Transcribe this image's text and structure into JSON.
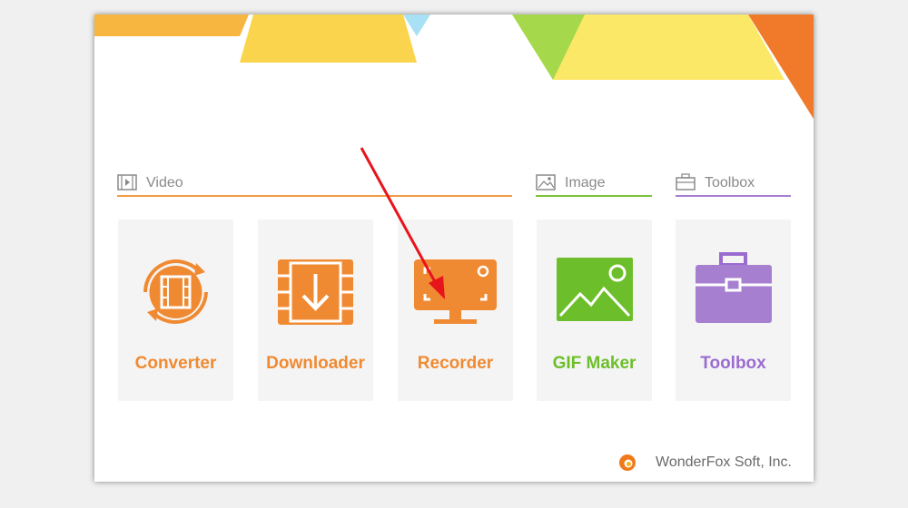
{
  "sections": {
    "video": {
      "label": "Video",
      "icon": "film-icon",
      "color": "#f39a45"
    },
    "image": {
      "label": "Image",
      "icon": "picture-icon",
      "color": "#7cc23a"
    },
    "toolbox": {
      "label": "Toolbox",
      "icon": "briefcase-icon",
      "color": "#a77fd0"
    }
  },
  "cards": [
    {
      "label": "Converter",
      "icon": "converter-film-icon",
      "color": "#f08a32"
    },
    {
      "label": "Downloader",
      "icon": "download-film-icon",
      "color": "#f08a32"
    },
    {
      "label": "Recorder",
      "icon": "screen-recorder-icon",
      "color": "#f08a32"
    },
    {
      "label": "GIF Maker",
      "icon": "gif-image-icon",
      "color": "#6cbf2a"
    },
    {
      "label": "Toolbox",
      "icon": "toolbox-icon",
      "color": "#9b6cd0"
    }
  ],
  "footer": {
    "brand": "WonderFox Soft, Inc.",
    "logo": "wonderfox-logo-icon"
  }
}
